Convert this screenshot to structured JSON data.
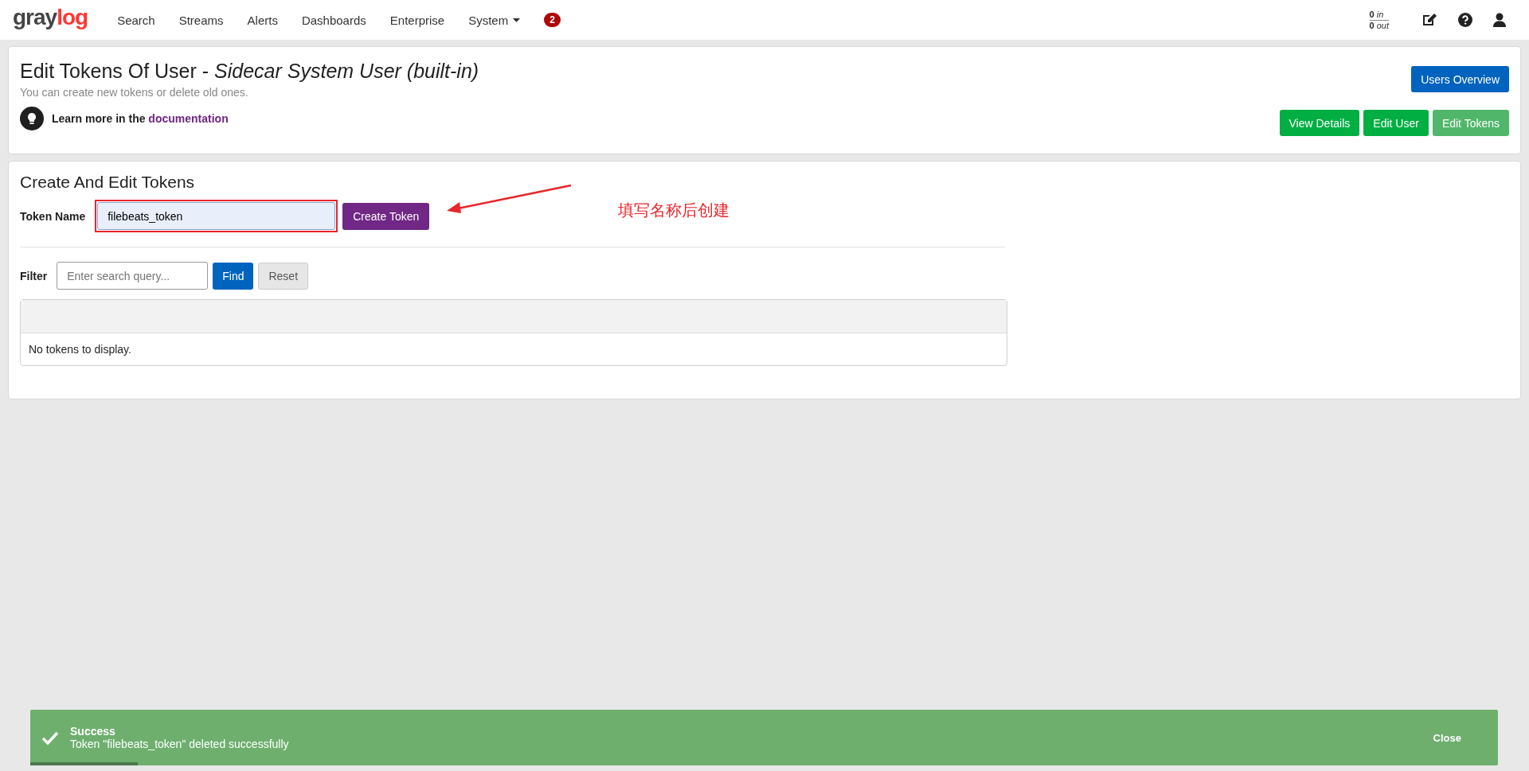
{
  "navbar": {
    "logo": {
      "first": "gray",
      "second": "log"
    },
    "items": [
      {
        "label": "Search",
        "kind": "link"
      },
      {
        "label": "Streams",
        "kind": "link"
      },
      {
        "label": "Alerts",
        "kind": "link"
      },
      {
        "label": "Dashboards",
        "kind": "link"
      },
      {
        "label": "Enterprise",
        "kind": "link"
      },
      {
        "label": "System",
        "kind": "dropdown"
      }
    ],
    "notification_badge": "2",
    "throughput": {
      "in_count": "0",
      "in_label": "in",
      "out_count": "0",
      "out_label": "out"
    }
  },
  "header": {
    "title": "Edit Tokens Of User - *Sidecar System User (built-in)*",
    "subtitle": "You can create new tokens or delete old ones.",
    "learn_more": "Learn more in the",
    "doc_link": "documentation",
    "overview_button": "Users Overview",
    "tabs": [
      {
        "label": "View Details",
        "selected": false
      },
      {
        "label": "Edit User",
        "selected": false
      },
      {
        "label": "Edit Tokens",
        "selected": true
      }
    ]
  },
  "tokens": {
    "heading": "Create And Edit Tokens",
    "name_label": "Token Name",
    "name_value": "filebeats_token",
    "create_button": "Create Token",
    "filter_label": "Filter",
    "filter_placeholder": "Enter search query...",
    "find_button": "Find",
    "reset_button": "Reset",
    "empty_message": "No tokens to display."
  },
  "annotation": {
    "note": "填写名称后创建"
  },
  "toast": {
    "title": "Success",
    "message": "Token \"filebeats_token\" deleted successfully",
    "close": "Close",
    "level": 0.073
  }
}
